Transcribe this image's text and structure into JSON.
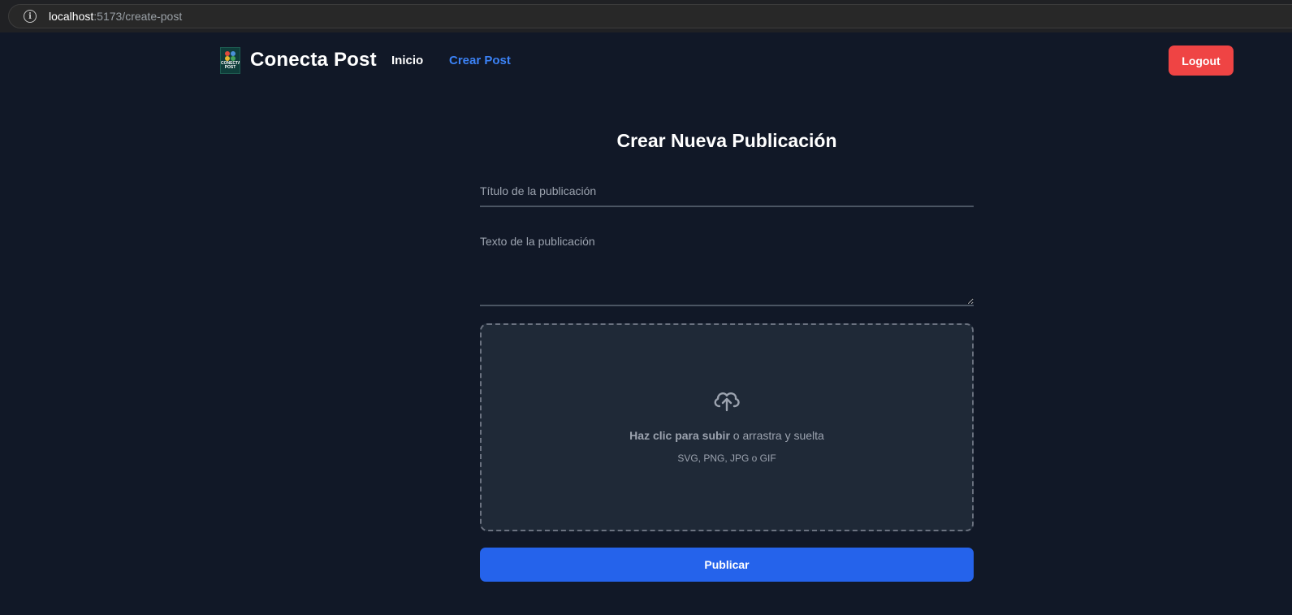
{
  "browser": {
    "url_host": "localhost",
    "url_path": ":5173/create-post",
    "info_icon": "info-icon"
  },
  "navbar": {
    "logo_text": "CONECTA POST",
    "brand": "Conecta Post",
    "links": [
      {
        "label": "Inicio",
        "active": false
      },
      {
        "label": "Crear Post",
        "active": true
      }
    ],
    "logout_label": "Logout",
    "active_color": "#3b82f6",
    "logout_color": "#ef4444"
  },
  "form": {
    "title": "Crear Nueva Publicación",
    "title_placeholder": "Título de la publicación",
    "text_placeholder": "Texto de la publicación",
    "dropzone": {
      "icon": "cloud-upload-icon",
      "click_text": "Haz clic para subir",
      "drag_text": " o arrastra y suelta",
      "formats": "SVG, PNG, JPG o GIF"
    },
    "publish_label": "Publicar",
    "publish_color": "#2563eb"
  }
}
